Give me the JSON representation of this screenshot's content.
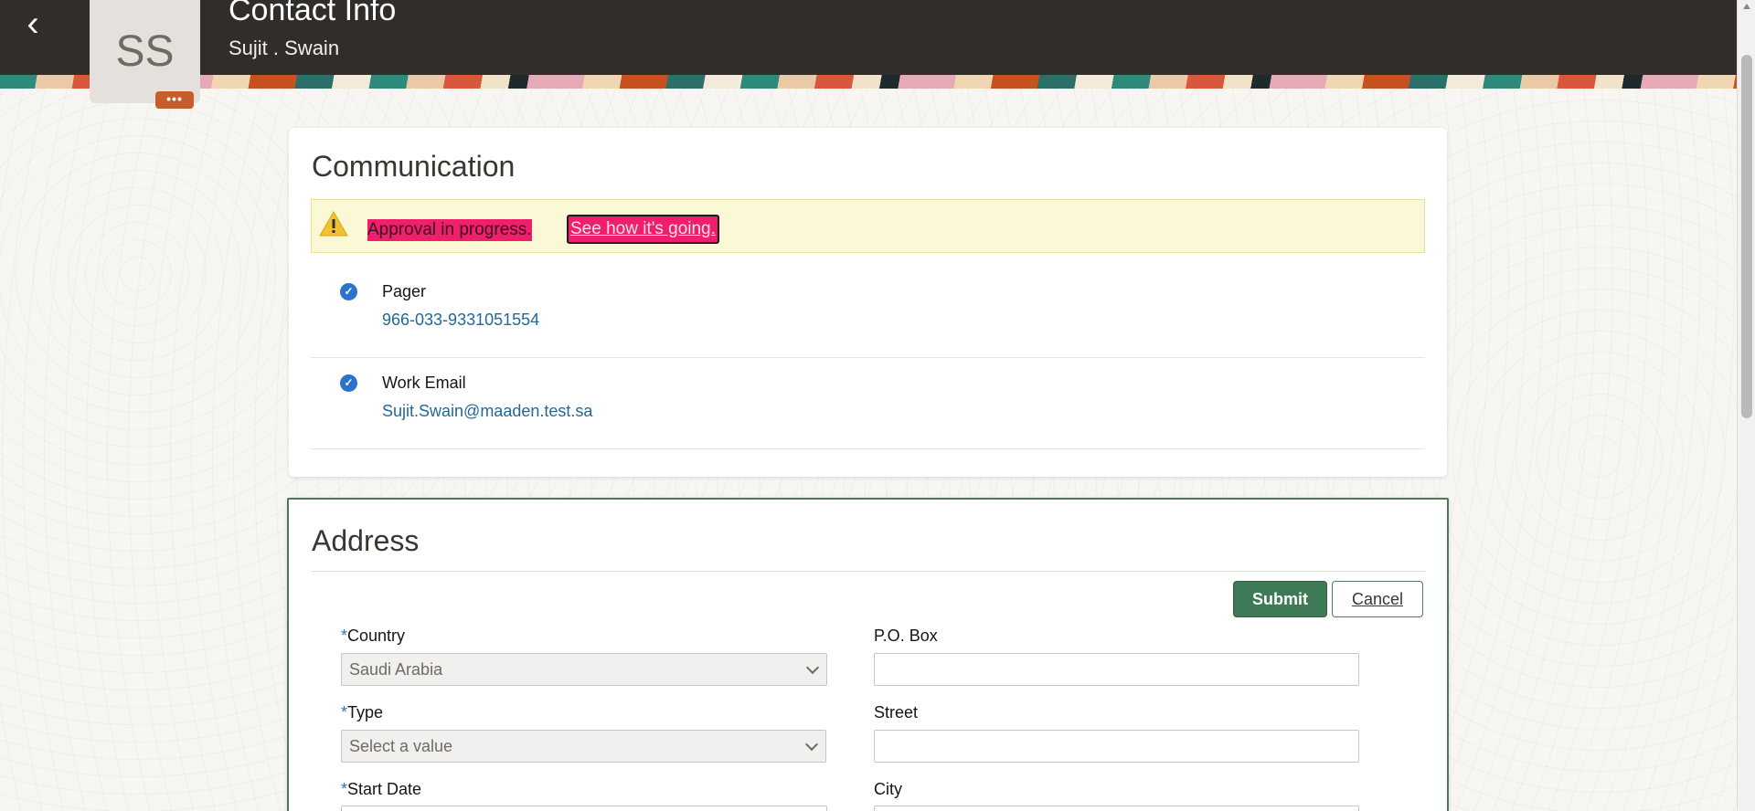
{
  "header": {
    "title": "Contact Info",
    "subtitle": "Sujit . Swain",
    "avatar_initials": "SS",
    "avatar_more": "•••",
    "back_glyph": "‹"
  },
  "communication": {
    "title": "Communication",
    "warning": {
      "text": "Approval in progress.",
      "link": "See how it's going."
    },
    "items": [
      {
        "label": "Pager",
        "value": "966-033-9331051554"
      },
      {
        "label": "Work Email",
        "value": "Sujit.Swain@maaden.test.sa"
      }
    ]
  },
  "address": {
    "title": "Address",
    "submit_label": "Submit",
    "cancel_label": "Cancel",
    "required_mark": "*",
    "fields": {
      "country": {
        "label": "Country",
        "value": "Saudi Arabia"
      },
      "po_box": {
        "label": "P.O. Box",
        "value": ""
      },
      "type": {
        "label": "Type",
        "placeholder": "Select a value"
      },
      "street": {
        "label": "Street",
        "value": ""
      },
      "start_date": {
        "label": "Start Date"
      },
      "city": {
        "label": "City"
      }
    }
  },
  "colors": {
    "header_bg": "#312d2a",
    "accent_green": "#3f7a57",
    "link_blue": "#226996",
    "highlight_pink": "#ef1f6b",
    "check_blue": "#2a73c9"
  },
  "icons": {
    "back": "chevron-left-icon",
    "warning": "warning-triangle-icon",
    "check": "check-circle-icon",
    "dropdown": "chevron-down-icon"
  }
}
